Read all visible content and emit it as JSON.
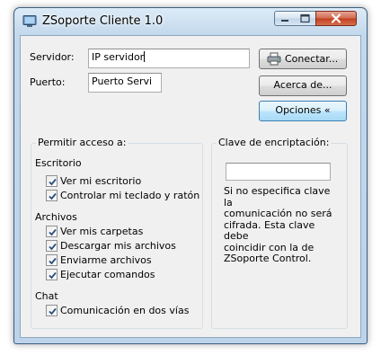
{
  "window": {
    "title": "ZSoporte Cliente 1.0"
  },
  "form": {
    "servidor_label": "Servidor:",
    "servidor_value": "IP servidor",
    "puerto_label": "Puerto:",
    "puerto_value": "Puerto Servi"
  },
  "buttons": {
    "conectar": "Conectar...",
    "acerca": "Acerca de...",
    "opciones": "Opciones «"
  },
  "permisos": {
    "title": "Permitir acceso a:",
    "sections": [
      {
        "title": "Escritorio",
        "items": [
          {
            "label": "Ver mi escritorio",
            "checked": true
          },
          {
            "label": "Controlar mi teclado y ratón",
            "checked": true
          }
        ]
      },
      {
        "title": "Archivos",
        "items": [
          {
            "label": "Ver mis carpetas",
            "checked": true
          },
          {
            "label": "Descargar mis archivos",
            "checked": true
          },
          {
            "label": "Enviarme archivos",
            "checked": true
          },
          {
            "label": "Ejecutar comandos",
            "checked": true
          }
        ]
      },
      {
        "title": "Chat",
        "items": [
          {
            "label": "Comunicación en dos vías",
            "checked": true
          }
        ]
      }
    ]
  },
  "clave": {
    "title": "Clave de encriptación:",
    "value": "",
    "note_lines": [
      "Si no especifica clave la",
      "comunicación no será",
      "cifrada. Esta clave debe",
      "coincidir con la de",
      "ZSoporte Control."
    ]
  },
  "icons": {
    "app": "monitor-icon",
    "conectar": "printer-network-icon",
    "check": "check-icon"
  }
}
